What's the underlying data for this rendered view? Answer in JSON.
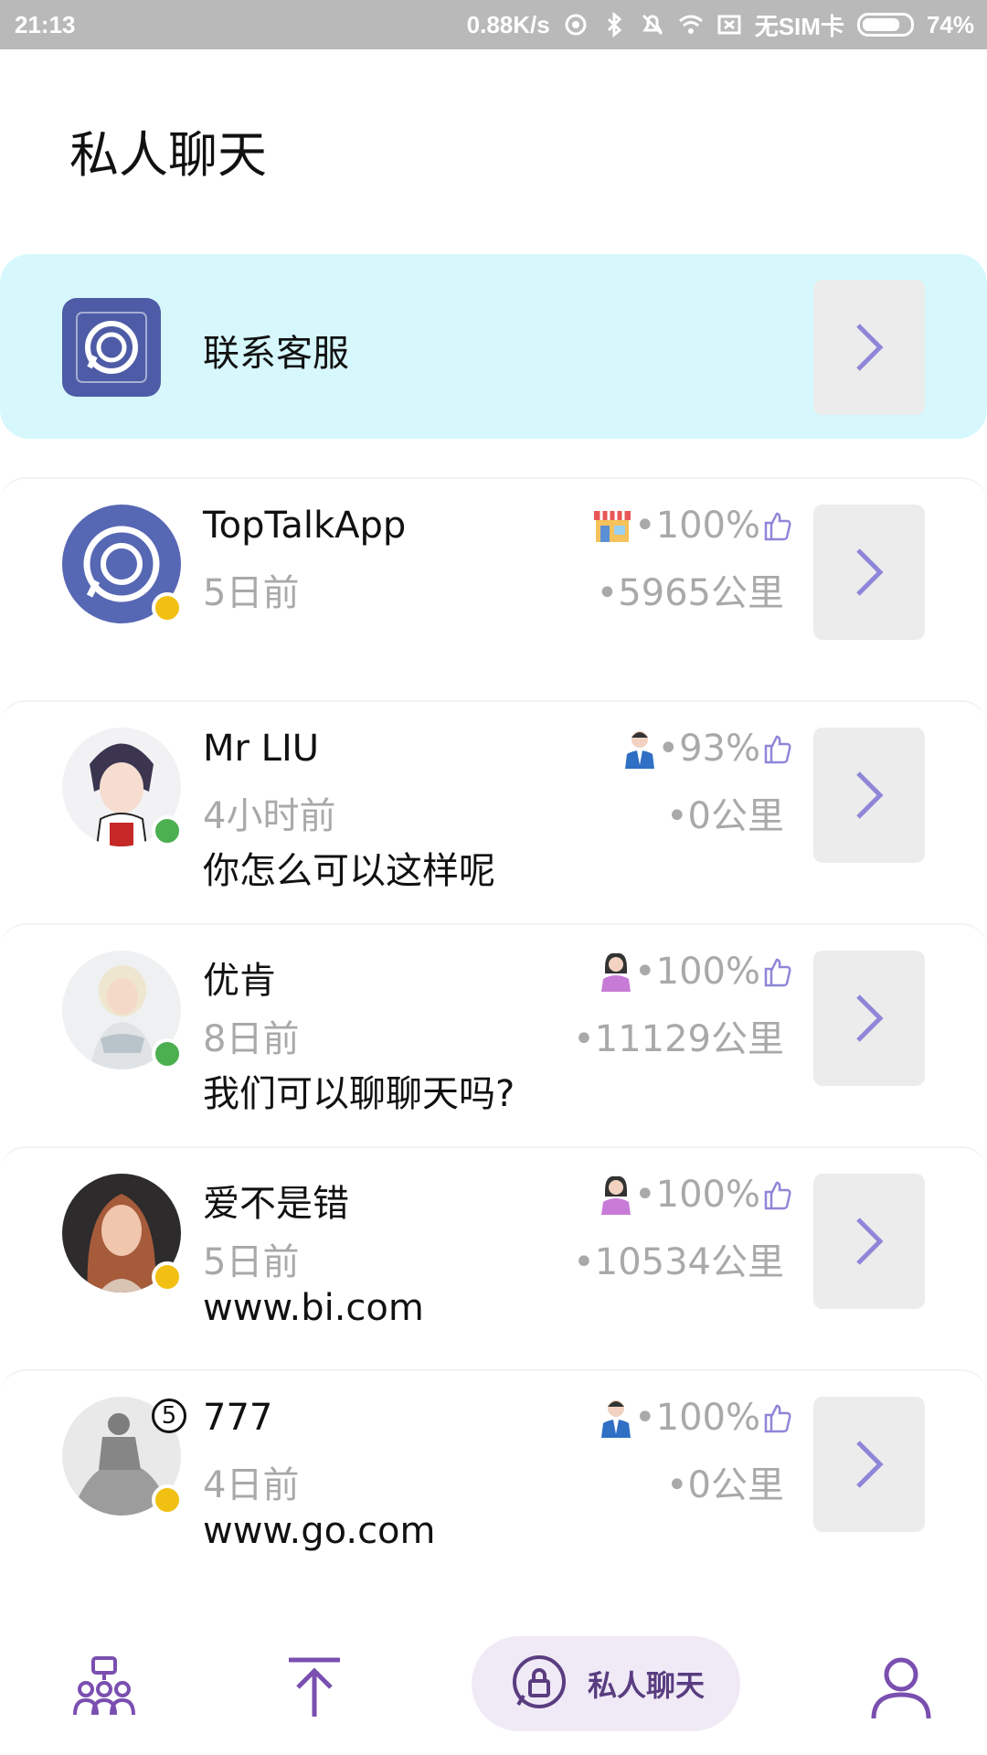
{
  "status_bar": {
    "time": "21:13",
    "net_speed": "0.88K/s",
    "carrier": "无SIM卡",
    "battery": "74%"
  },
  "header": {
    "title": "私人聊天"
  },
  "support": {
    "label": "联系客服"
  },
  "chats": [
    {
      "name": "TopTalkApp",
      "time": "5日前",
      "message": "",
      "rating": "•100%",
      "distance": "•5965公里",
      "status": "away",
      "role_icon": "shop-icon"
    },
    {
      "name": "Mr LIU",
      "time": "4小时前",
      "message": "你怎么可以这样呢",
      "rating": "•93%",
      "distance": "•0公里",
      "status": "online",
      "role_icon": "male-user-icon"
    },
    {
      "name": "优肯",
      "time": "8日前",
      "message": "我们可以聊聊天吗?",
      "rating": "•100%",
      "distance": "•11129公里",
      "status": "online",
      "role_icon": "female-user-icon"
    },
    {
      "name": "爱不是错",
      "time": "5日前",
      "message": "www.bi.com",
      "rating": "•100%",
      "distance": "•10534公里",
      "status": "away",
      "role_icon": "female-user-icon"
    },
    {
      "name": "777",
      "time": "4日前",
      "message": "www.go.com",
      "rating": "•100%",
      "distance": "•0公里",
      "status": "away",
      "role_icon": "male-user-icon",
      "unread": "5"
    }
  ],
  "bottom_nav": {
    "items": [
      "groups-icon",
      "upload-icon",
      "private-chat-icon",
      "profile-icon"
    ],
    "active_label": "私人聊天"
  },
  "colors": {
    "accent": "#8e86d8",
    "online": "#4caf50",
    "away": "#f2c012",
    "support_bg": "#d6f8fc",
    "nav_active": "#5a3d80"
  }
}
